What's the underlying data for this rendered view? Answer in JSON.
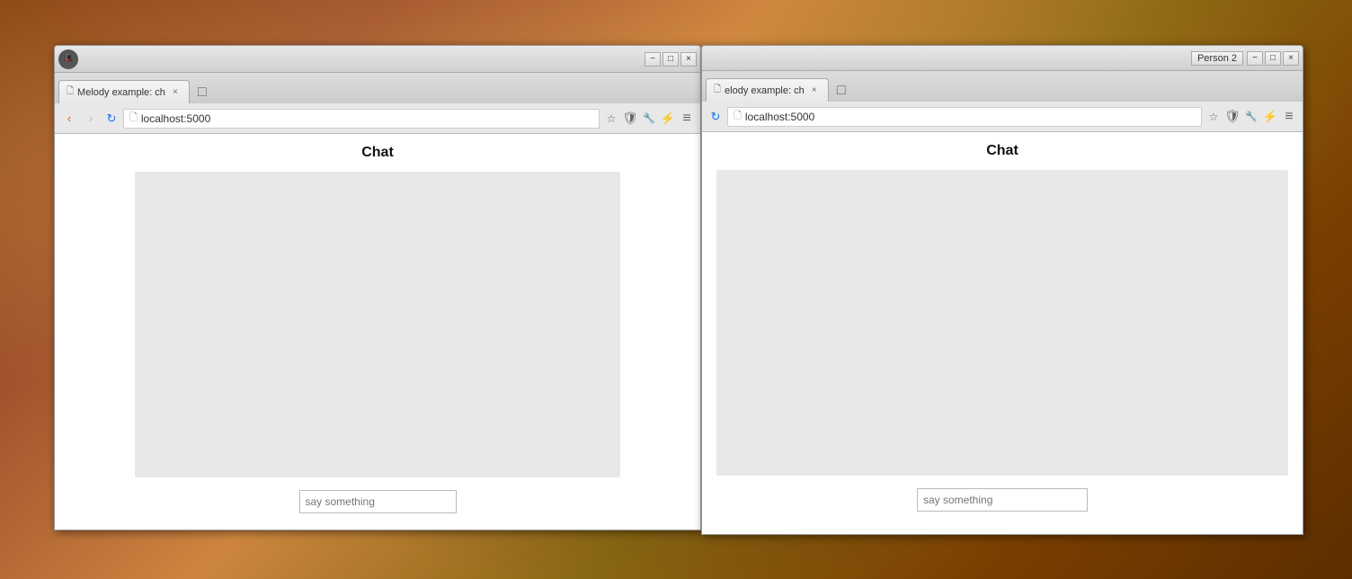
{
  "background": {
    "description": "Warm brown/orange blurred background photo"
  },
  "window1": {
    "title_bar": {
      "controls": [
        "minimize",
        "maximize",
        "close"
      ],
      "minimize_label": "−",
      "maximize_label": "□",
      "close_label": "×"
    },
    "tab": {
      "title": "Melody example: ch",
      "close_label": "×",
      "favicon": "page"
    },
    "new_tab_label": "□",
    "address_bar": {
      "url": "localhost:5000",
      "back_label": "‹",
      "forward_label": "›",
      "refresh_label": "↻",
      "page_icon": "🗋",
      "star_label": "☆",
      "shield_label": "🛡",
      "tools_label": "🔧",
      "sync_label": "⚡",
      "menu_label": "≡"
    },
    "page": {
      "chat_title": "Chat",
      "input_placeholder": "say something"
    }
  },
  "window2": {
    "title_bar": {
      "person2_label": "Person 2",
      "minimize_label": "−",
      "maximize_label": "□",
      "close_label": "×"
    },
    "tab": {
      "title": "elody example: ch",
      "close_label": "×",
      "favicon": "page"
    },
    "new_tab_label": "□",
    "address_bar": {
      "url": "localhost:5000",
      "refresh_label": "↻",
      "page_icon": "🗋",
      "star_label": "☆",
      "shield_label": "🛡",
      "tools_label": "🔧",
      "sync_label": "⚡",
      "menu_label": "≡"
    },
    "page": {
      "chat_title": "Chat",
      "input_placeholder": "say something"
    }
  }
}
